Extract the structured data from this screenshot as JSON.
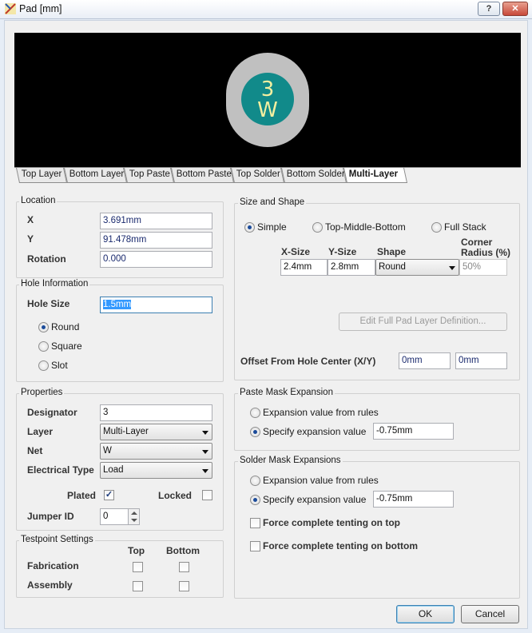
{
  "window": {
    "title": "Pad [mm]",
    "help_btn": "?",
    "close_btn": "✕"
  },
  "preview": {
    "line1": "3",
    "line2": "W",
    "tabs": [
      "Top Layer",
      "Bottom Layer",
      "Top Paste",
      "Bottom Paste",
      "Top Solder",
      "Bottom Solder",
      "Multi-Layer"
    ],
    "active_tab": "Multi-Layer"
  },
  "location": {
    "title": "Location",
    "x_label": "X",
    "x_value": "3.691mm",
    "y_label": "Y",
    "y_value": "91.478mm",
    "rot_label": "Rotation",
    "rot_value": "0.000"
  },
  "hole": {
    "title": "Hole Information",
    "size_label": "Hole Size",
    "size_value": "1.5mm",
    "options": [
      "Round",
      "Square",
      "Slot"
    ],
    "selected": "Round"
  },
  "properties": {
    "title": "Properties",
    "designator_label": "Designator",
    "designator_value": "3",
    "layer_label": "Layer",
    "layer_value": "Multi-Layer",
    "net_label": "Net",
    "net_value": "W",
    "etype_label": "Electrical Type",
    "etype_value": "Load",
    "plated_label": "Plated",
    "plated_checked": "✓",
    "locked_label": "Locked",
    "jumper_label": "Jumper ID",
    "jumper_value": "0"
  },
  "testpoint": {
    "title": "Testpoint Settings",
    "top_label": "Top",
    "bottom_label": "Bottom",
    "fab_label": "Fabrication",
    "asm_label": "Assembly"
  },
  "size_shape": {
    "title": "Size and Shape",
    "modes": [
      "Simple",
      "Top-Middle-Bottom",
      "Full Stack"
    ],
    "selected": "Simple",
    "xsize_label": "X-Size",
    "ysize_label": "Y-Size",
    "shape_label": "Shape",
    "corner_label1": "Corner",
    "corner_label2": "Radius (%)",
    "xsize_value": "2.4mm",
    "ysize_value": "2.8mm",
    "shape_value": "Round",
    "corner_value": "50%",
    "edit_btn": "Edit Full Pad Layer Definition...",
    "offset_label": "Offset From Hole Center (X/Y)",
    "offset_x": "0mm",
    "offset_y": "0mm"
  },
  "paste": {
    "title": "Paste Mask Expansion",
    "opt_rules": "Expansion value from rules",
    "opt_specify": "Specify expansion value",
    "value": "-0.75mm"
  },
  "solder": {
    "title": "Solder Mask Expansions",
    "opt_rules": "Expansion value from rules",
    "opt_specify": "Specify expansion value",
    "value": "-0.75mm",
    "tent_top": "Force complete tenting on top",
    "tent_bottom": "Force complete tenting on bottom"
  },
  "footer": {
    "ok": "OK",
    "cancel": "Cancel"
  },
  "colors": {
    "preview_bg": "#000000",
    "pad_ring": "#c0c0c0",
    "pad_hole": "#118a8a",
    "pad_text": "#f3efa0"
  }
}
